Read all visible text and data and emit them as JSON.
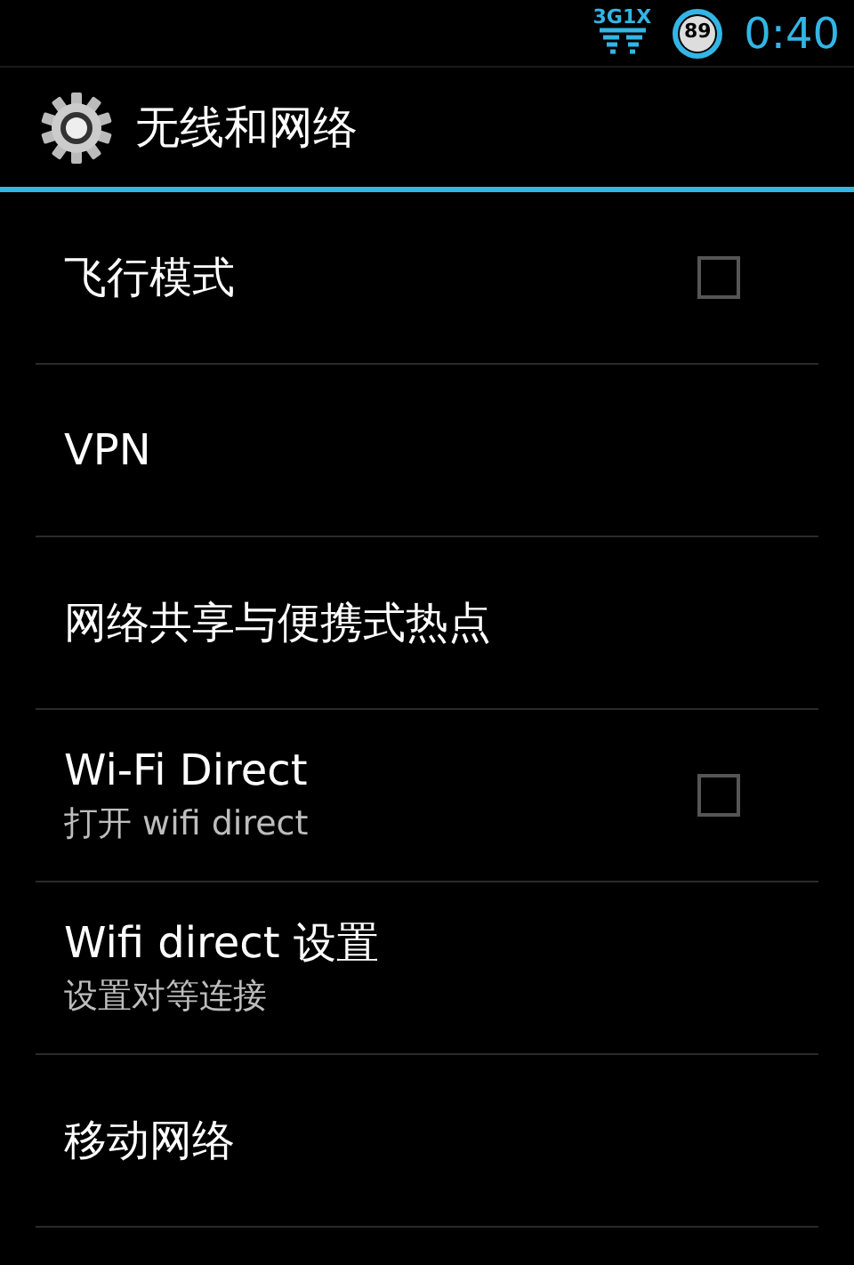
{
  "status_bar": {
    "network_top": "3G",
    "network_bottom": "1X",
    "battery": "89",
    "time": "0:40"
  },
  "header": {
    "title": "无线和网络"
  },
  "items": [
    {
      "kind": "checkbox",
      "title": "飞行模式",
      "checked": false
    },
    {
      "kind": "plain",
      "title": "VPN"
    },
    {
      "kind": "plain",
      "title": "网络共享与便携式热点"
    },
    {
      "kind": "checkbox",
      "title": "Wi-Fi Direct",
      "subtitle": "打开 wifi direct",
      "checked": false
    },
    {
      "kind": "plain",
      "title": "Wifi direct 设置",
      "subtitle": "设置对等连接"
    },
    {
      "kind": "plain",
      "title": "移动网络"
    }
  ]
}
